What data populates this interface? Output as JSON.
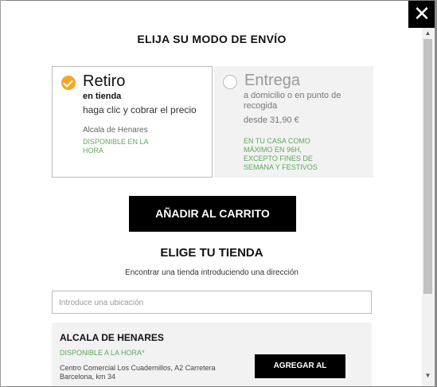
{
  "modal": {
    "title": "ELIJA SU MODO DE ENVÍO",
    "close_label": "✕"
  },
  "options": {
    "pickup": {
      "title": "Retiro",
      "subtitle": "en tienda",
      "description": "haga clic y cobrar el precio",
      "store": "Alcala de Henares",
      "availability": "DISPONIBLE EN LA HORA"
    },
    "delivery": {
      "title": "Entrega",
      "subtitle": "a domicilio o en punto de recogida",
      "price": "desde 31,90 €",
      "note": "EN TU CASA COMO MÁXIMO EN 96H, EXCEPTO FINES DE SEMANA Y FESTIVOS"
    }
  },
  "add_to_cart": "AÑADIR AL CARRITO",
  "store_section": {
    "title": "ELIGE TU TIENDA",
    "hint": "Encontrar una tienda introduciendo una dirección",
    "search_placeholder": "Introduce una ubicación"
  },
  "store": {
    "name": "ALCALA DE HENARES",
    "availability": "DISPONIBLE A LA HORA*",
    "address": "Centro Comercial Los Cuadernillos, A2 Carretera Barcelona, km 34",
    "button": "AGREGAR AL CARRITO"
  },
  "colors": {
    "accent": "#f5a623",
    "available_green": "#5ca85c",
    "button_bg": "#000000"
  }
}
